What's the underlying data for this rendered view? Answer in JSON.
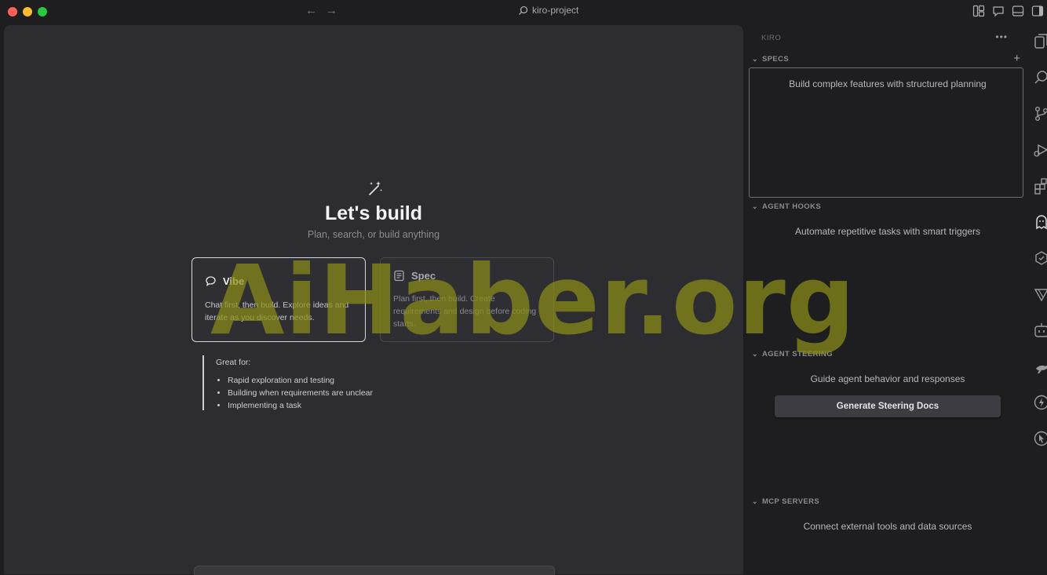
{
  "titlebar": {
    "project_name": "kiro-project",
    "back_arrow": "←",
    "forward_arrow": "→"
  },
  "editor": {
    "heading": "Let's build",
    "subheading": "Plan, search, or build anything",
    "modes": [
      {
        "label": "Vibe",
        "description": "Chat first, then build. Explore ideas and iterate as you discover needs.",
        "selected": true
      },
      {
        "label": "Spec",
        "description": "Plan first, then build. Create requirements and design before coding starts.",
        "selected": false
      }
    ],
    "great_for": {
      "label": "Great for:",
      "items": [
        "Rapid exploration and testing",
        "Building when requirements are unclear",
        "Implementing a task"
      ]
    }
  },
  "sidepanel": {
    "title": "KIRO",
    "more": "•••",
    "add": "+",
    "sections": [
      {
        "title": "SPECS",
        "text": "Build complex features with structured planning"
      },
      {
        "title": "AGENT HOOKS",
        "text": "Automate repetitive tasks with smart triggers"
      },
      {
        "title": "AGENT STEERING",
        "text": "Guide agent behavior and responses",
        "button": "Generate Steering Docs"
      },
      {
        "title": "MCP SERVERS",
        "text": "Connect external tools and data sources"
      }
    ]
  },
  "watermark": "AiHaber.org",
  "colors": {
    "background": "#1d1d20",
    "editor": "#2d2c30",
    "watermark": "#8b8e18"
  }
}
